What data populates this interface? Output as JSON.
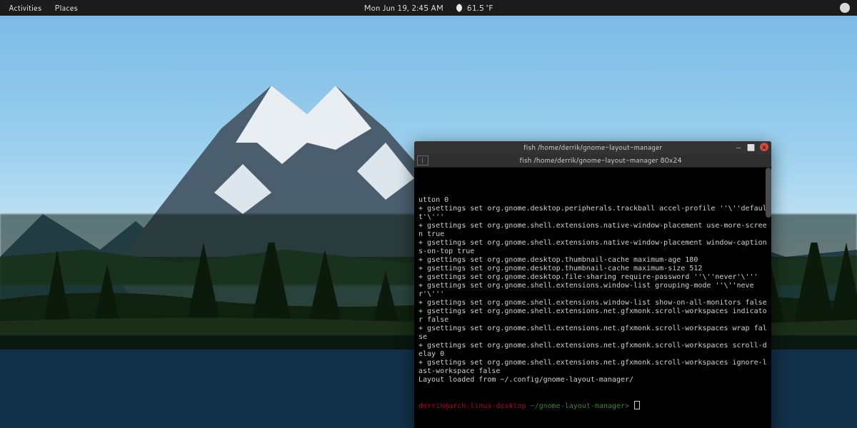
{
  "panel": {
    "activities": "Activities",
    "places": "Places",
    "clock": "Mon Jun 19,  2:45 AM",
    "temperature": "61.5 °F"
  },
  "terminal": {
    "window_title": "fish  /home/derrik/gnome-layout-manager",
    "tab_title": "fish  /home/derrik/gnome-layout-manager 80x24",
    "lines": [
      "utton 0",
      "+ gsettings set org.gnome.desktop.peripherals.trackball accel-profile ''\\''default'\\'''",
      "+ gsettings set org.gnome.shell.extensions.native-window-placement use-more-screen true",
      "+ gsettings set org.gnome.shell.extensions.native-window-placement window-captions-on-top true",
      "+ gsettings set org.gnome.desktop.thumbnail-cache maximum-age 180",
      "+ gsettings set org.gnome.desktop.thumbnail-cache maximum-size 512",
      "+ gsettings set org.gnome.desktop.file-sharing require-password ''\\''never'\\'''",
      "+ gsettings set org.gnome.shell.extensions.window-list grouping-mode ''\\''never'\\'''",
      "+ gsettings set org.gnome.shell.extensions.window-list show-on-all-monitors false",
      "+ gsettings set org.gnome.shell.extensions.net.gfxmonk.scroll-workspaces indicator false",
      "+ gsettings set org.gnome.shell.extensions.net.gfxmonk.scroll-workspaces wrap false",
      "+ gsettings set org.gnome.shell.extensions.net.gfxmonk.scroll-workspaces scroll-delay 0",
      "+ gsettings set org.gnome.shell.extensions.net.gfxmonk.scroll-workspaces ignore-last-workspace false",
      "Layout loaded from ~/.config/gnome-layout-manager/"
    ],
    "prompt": {
      "user_host": "derrik@arch-linux-desktop",
      "path": "~/gnome-layout-manager>"
    },
    "controls": {
      "minimize": "—",
      "maximize": "⬜",
      "close": "✕"
    }
  }
}
